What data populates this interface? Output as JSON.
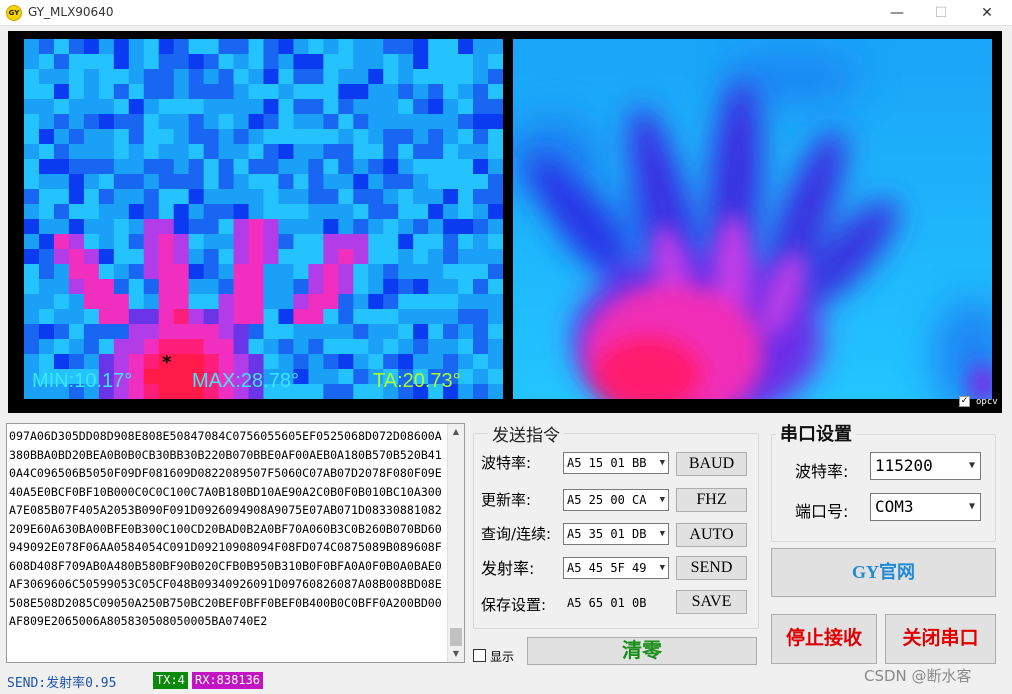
{
  "window": {
    "title": "GY_MLX90640",
    "icon_text": "GY",
    "minimize_glyph": "—",
    "maximize_glyph": "☐",
    "close_glyph": "✕"
  },
  "display": {
    "min_label": "MIN:10.17°",
    "max_label": "MAX:28.78°",
    "ta_label": "TA:20.73°",
    "hot_marker": "*",
    "min_color": "#38e8ff",
    "max_color": "#38e8ff",
    "ta_color": "#aaff2a",
    "opcv_checked": true,
    "opcv_label": "opcv"
  },
  "hex_log": {
    "text": "097A06D305DD08D908E808E50847084C0756055605EF0525068D072D08600A380BBA0BD20BEA0B0B0CB30BB30B220B070BBE0AF00AEB0A180B570B520B410A4C096506B5050F09DF081609D0822089507F5060C07AB07D2078F080F09E40A5E0BCF0BF10B000C0C0C100C7A0B180BD10AE90A2C0B0F0B010BC10A300A7E085B07F405A2053B090F091D0926094908A9075E07AB071D08330881082209E60A630BA00BFE0B300C100CD20BAD0B2A0BF70A060B3C0B260B070BD60949092E078F06AA0584054C091D09210908094F08FD074C0875089B089608F608D408F709AB0A480B580BF90B020CFB0B950B310B0F0BFA0A0F0B0A0BAE0AF3069606C50599053C05CF048B09340926091D09760826087A08B008BD08E508E508D2085C09050A250B750BC20BEF0BFF0BEF0B400B0C0BFF0A200BD00AF809E2065006A805830508050005BA0740E2"
  },
  "send_commands": {
    "title": "发送指令",
    "rows": [
      {
        "label": "波特率:",
        "value": "A5 15 01 BB",
        "button": "BAUD"
      },
      {
        "label": "更新率:",
        "value": "A5 25 00 CA",
        "button": "FHZ"
      },
      {
        "label": "查询/连续:",
        "value": "A5 35 01 DB",
        "button": "AUTO"
      },
      {
        "label": "发射率:",
        "value": "A5 45 5F 49",
        "button": "SEND"
      }
    ],
    "save_label": "保存设置:",
    "save_value": "A5 65 01 0B",
    "save_button": "SAVE"
  },
  "show_checkbox": {
    "label": "显示",
    "checked": false
  },
  "clear_button": "清零",
  "serial": {
    "title": "串口设置",
    "baud_label": "波特率:",
    "baud_value": "115200",
    "port_label": "端口号:",
    "port_value": "COM3",
    "website_button": "GY官网",
    "stop_button": "停止接收",
    "close_button": "关闭串口"
  },
  "status": {
    "send_text": "SEND:发射率0.95",
    "tx_text": "TX:4",
    "rx_text": "RX:838136",
    "tx_color": "#0a8a0a",
    "rx_color": "#c214c2"
  },
  "watermark": "CSDN @断水客"
}
